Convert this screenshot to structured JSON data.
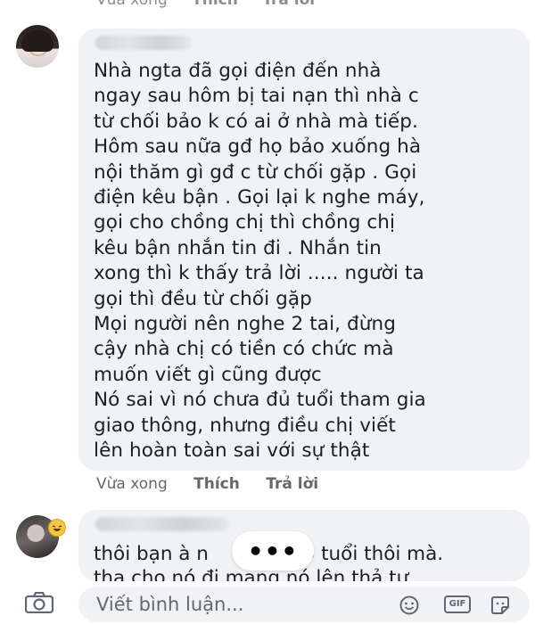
{
  "top_actions": {
    "time": "Vừa xong",
    "like": "Thích",
    "reply": "Trả lời"
  },
  "comment": {
    "lines": [
      "Nhà ngta đã gọi điện đến nhà",
      "ngay sau hôm bị tai nạn thì nhà c",
      "từ chối bảo k có ai ở nhà mà tiếp.",
      "Hôm sau nữa gđ họ bảo xuống hà",
      "nội thăm gì gđ c từ chối gặp . Gọi",
      "điện kêu bận . Gọi lại k nghe máy,",
      "gọi cho chồng chị thì chồng chị",
      "kêu bận nhắn tin đi . Nhắn tin",
      "xong thì k thấy trả lời   ..... người ta",
      "gọi thì đều từ chối gặp",
      "Mọi người nên nghe 2 tai, đừng",
      "cậy nhà chị có tiền có chức mà",
      "muốn viết gì cũng được",
      "Nó sai vì nó chưa đủ tuổi tham gia",
      "giao thông, nhưng điều chị viết",
      "lên hoàn toàn sai với sự thật"
    ]
  },
  "actions": {
    "time": "Vừa xong",
    "like": "Thích",
    "reply": "Trả lời"
  },
  "reply": {
    "line1_start": "thôi bạn à n",
    "line1_end": "15 tuổi thôi mà.",
    "line2": "tha cho nó đi mang nó lên thả tự",
    "typing": "•••"
  },
  "composer": {
    "placeholder": "Viết bình luận...",
    "gif": "GIF",
    "icons": [
      "camera-icon",
      "emoji-icon",
      "gif-icon",
      "sticker-icon"
    ]
  },
  "colors": {
    "bubble": "#f0f2f5",
    "meta": "#65676b",
    "text": "#1c1e21"
  }
}
